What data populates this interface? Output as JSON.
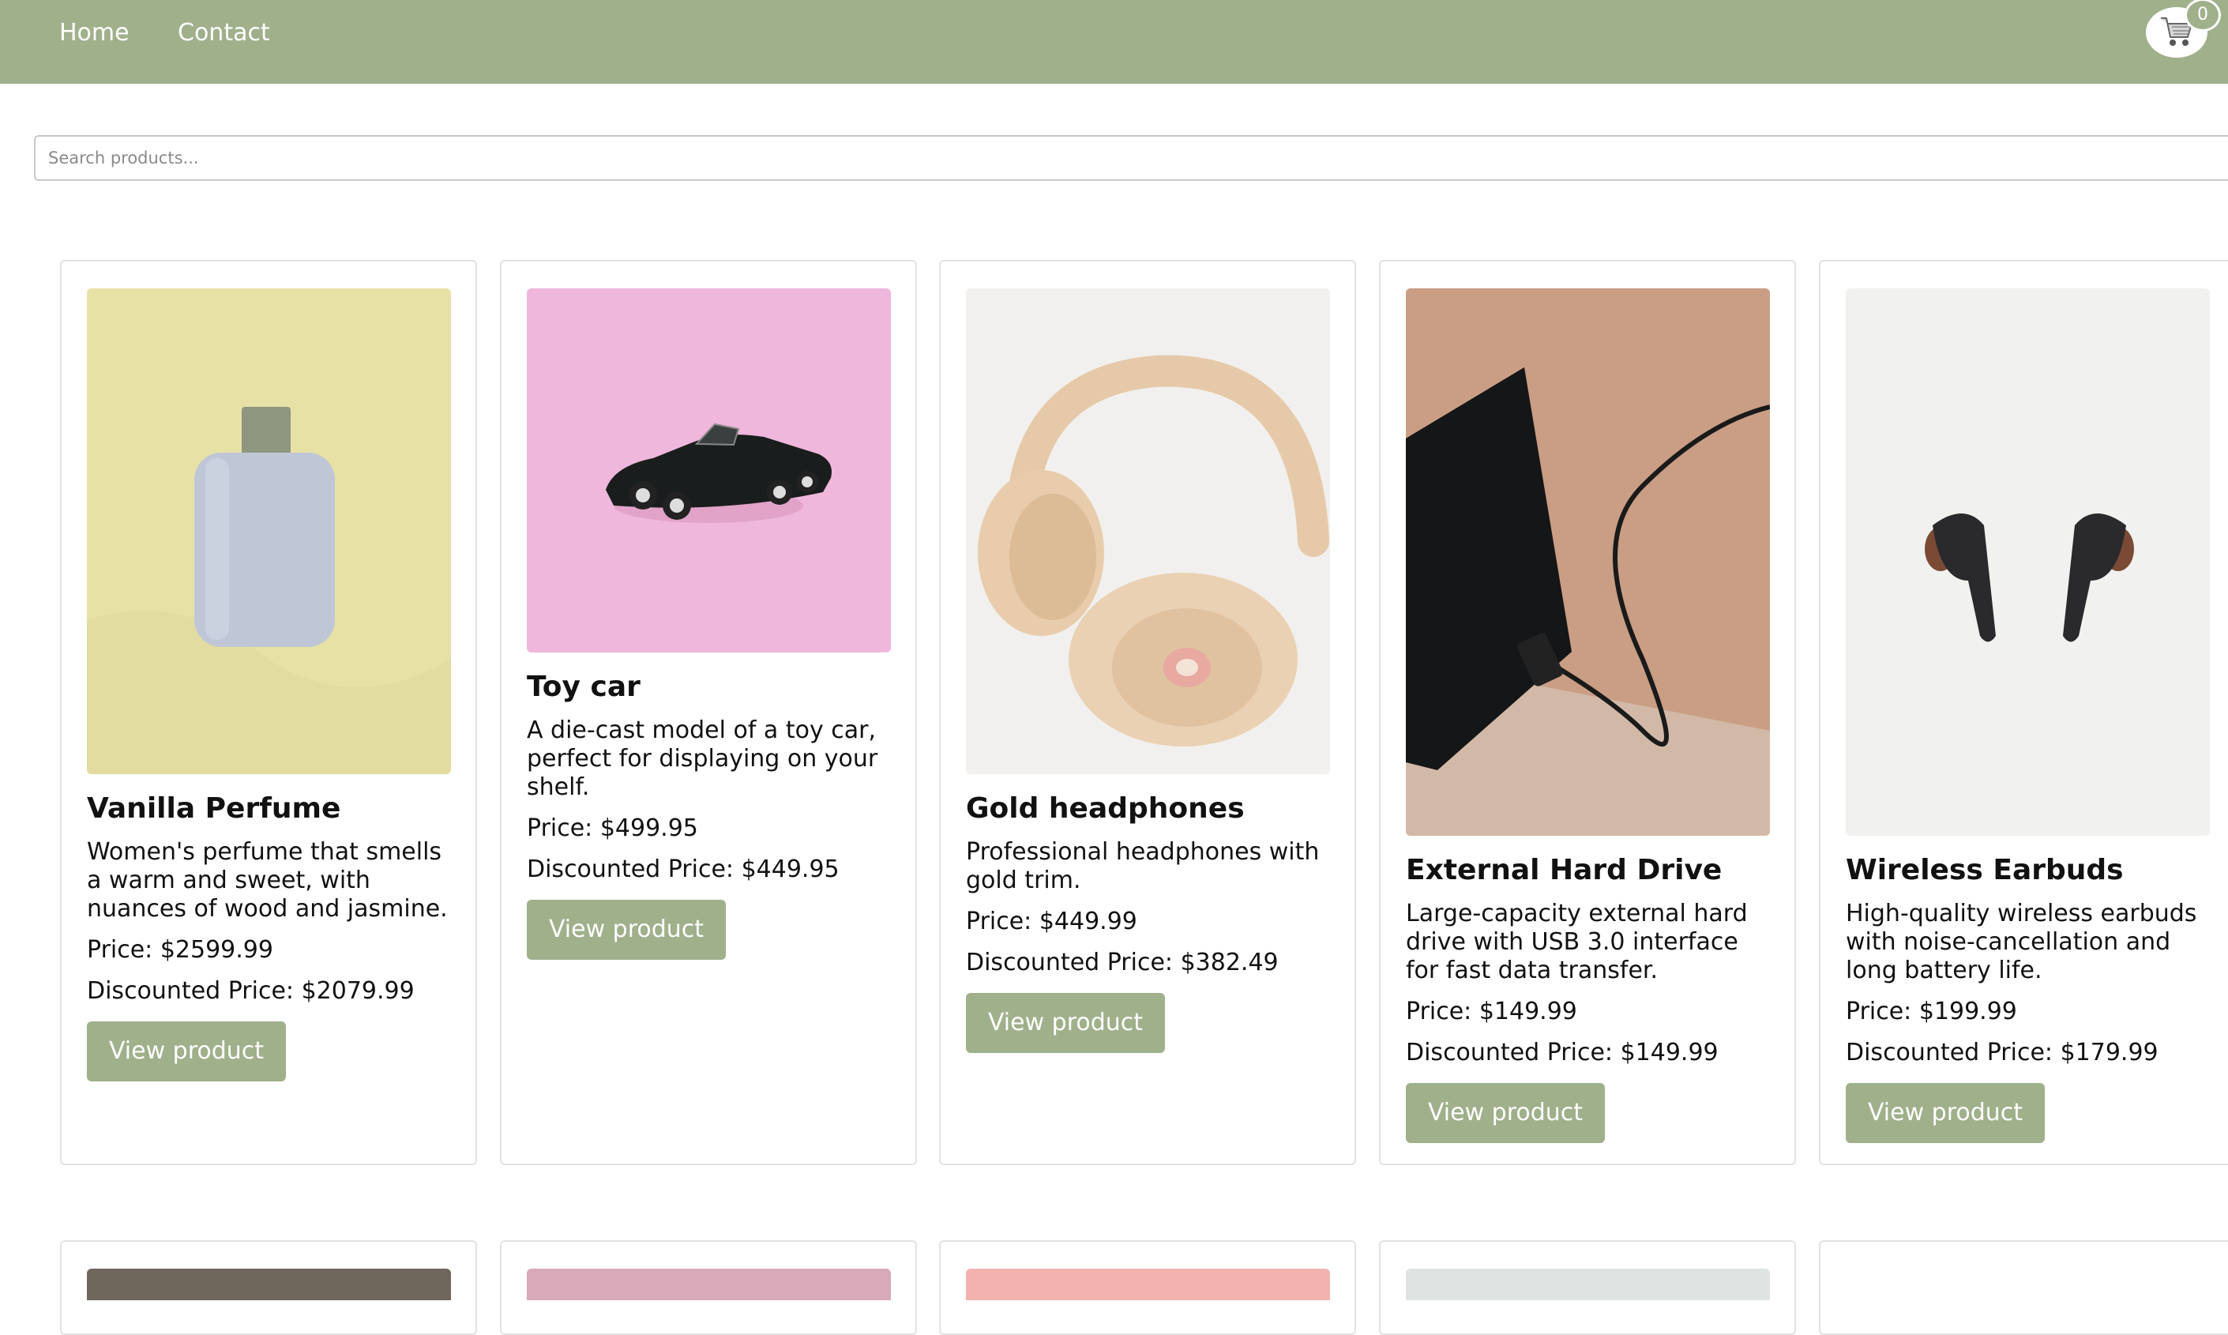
{
  "nav": {
    "home": "Home",
    "contact": "Contact"
  },
  "cart": {
    "count": "0",
    "icon": "shopping-cart-icon"
  },
  "search": {
    "placeholder": "Search products...",
    "value": ""
  },
  "products": [
    {
      "title": "Vanilla Perfume",
      "description": "Women's perfume that smells a warm and sweet, with nuances of wood and jasmine.",
      "price": "Price: $2599.99",
      "discounted": "Discounted Price: $2079.99",
      "button": "View product",
      "image_bg": "#e8e1a6"
    },
    {
      "title": "Toy car",
      "description": "A die-cast model of a toy car, perfect for displaying on your shelf.",
      "price": "Price: $499.95",
      "discounted": "Discounted Price: $449.95",
      "button": "View product",
      "image_bg": "#efb7db"
    },
    {
      "title": "Gold headphones",
      "description": "Professional headphones with gold trim.",
      "price": "Price: $449.99",
      "discounted": "Discounted Price: $382.49",
      "button": "View product",
      "image_bg": "#f1f0ee"
    },
    {
      "title": "External Hard Drive",
      "description": "Large-capacity external hard drive with USB 3.0 interface for fast data transfer.",
      "price": "Price: $149.99",
      "discounted": "Discounted Price: $149.99",
      "button": "View product",
      "image_bg": "#caa188"
    },
    {
      "title": "Wireless Earbuds",
      "description": "High-quality wireless earbuds with noise-cancellation and long battery life.",
      "price": "Price: $199.99",
      "discounted": "Discounted Price: $179.99",
      "button": "View product",
      "image_bg": "#f1f1ef"
    }
  ],
  "colors": {
    "brand": "#9fb08b",
    "card_border": "#e2e2e2"
  }
}
